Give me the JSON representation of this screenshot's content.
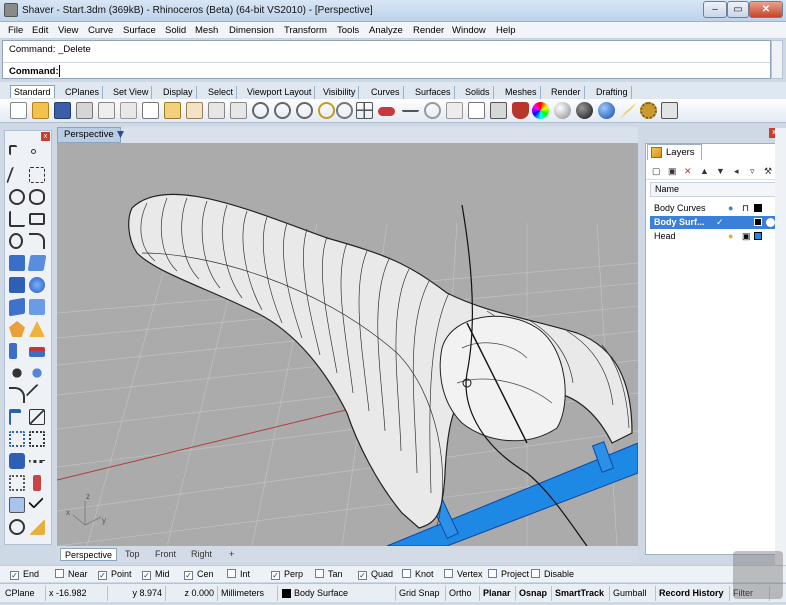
{
  "window": {
    "title": "Shaver - Start.3dm (369kB) - Rhinoceros (Beta) (64-bit VS2010) - [Perspective]",
    "minimize": "‒",
    "maximize": "▭",
    "close": "✕"
  },
  "menu": [
    "File",
    "Edit",
    "View",
    "Curve",
    "Surface",
    "Solid",
    "Mesh",
    "Dimension",
    "Transform",
    "Tools",
    "Analyze",
    "Render",
    "Window",
    "Help"
  ],
  "command": {
    "history": "Command: _Delete",
    "prompt": "Command:",
    "input_value": ""
  },
  "toolbar_tabs": [
    "Standard",
    "CPlanes",
    "Set View",
    "Display",
    "Select",
    "Viewport Layout",
    "Visibility",
    "Curves",
    "Surfaces",
    "Solids",
    "Meshes",
    "Render",
    "Drafting"
  ],
  "toolbar_tools": [
    "new-icon",
    "open-icon",
    "save-icon",
    "print-icon",
    "import-icon",
    "cut-icon",
    "copy-icon",
    "paste-icon",
    "pan-hand-icon",
    "undo-icon",
    "redo-icon",
    "zoom-icon",
    "zoom-window-icon",
    "zoom-extents-icon",
    "zoom-selected-icon",
    "rotate-view-icon",
    "four-view-icon",
    "car-icon",
    "line-icon",
    "circle-icon",
    "select-icon",
    "properties-icon",
    "cube-icon",
    "lightbulb-icon",
    "shield-icon",
    "color-wheel-icon",
    "sphere-gray-icon",
    "sphere-black-icon",
    "sphere-blue-icon",
    "pen-icon",
    "gear-icon",
    "transform-icon"
  ],
  "viewport": {
    "name": "Perspective",
    "tabs": [
      "Perspective",
      "Top",
      "Front",
      "Right"
    ],
    "add_tab": "+",
    "axis_z": "z",
    "axis_y": "y",
    "axis_x": "x"
  },
  "layers": {
    "tab_label": "Layers",
    "column_header": "Name",
    "rows": [
      {
        "name": "Body Curves",
        "color": "#000000",
        "selected": false
      },
      {
        "name": "Body Surf...",
        "color": "#000000",
        "selected": true
      },
      {
        "name": "Head",
        "color": "#1e88e5",
        "selected": false
      }
    ]
  },
  "osnap": [
    {
      "label": "End",
      "checked": true
    },
    {
      "label": "Near",
      "checked": false
    },
    {
      "label": "Point",
      "checked": true
    },
    {
      "label": "Mid",
      "checked": true
    },
    {
      "label": "Cen",
      "checked": true
    },
    {
      "label": "Int",
      "checked": false
    },
    {
      "label": "Perp",
      "checked": true
    },
    {
      "label": "Tan",
      "checked": false
    },
    {
      "label": "Quad",
      "checked": true
    },
    {
      "label": "Knot",
      "checked": false
    },
    {
      "label": "Vertex",
      "checked": false
    },
    {
      "label": "Project",
      "checked": false
    },
    {
      "label": "Disable",
      "checked": false
    }
  ],
  "status": {
    "cplane": "CPlane",
    "x": "x -16.982",
    "y": "y 8.974",
    "z": "z 0.000",
    "units": "Millimeters",
    "layer": "Body Surface",
    "grid_snap": "Grid Snap",
    "ortho": "Ortho",
    "planar": "Planar",
    "osnap": "Osnap",
    "smarttrack": "SmartTrack",
    "gumball": "Gumball",
    "record_history": "Record History",
    "filter": "Filter"
  },
  "colors": {
    "accent": "#3a7fd8",
    "viewport_bg": "#ababab",
    "handle_blue": "#1e88e5"
  }
}
